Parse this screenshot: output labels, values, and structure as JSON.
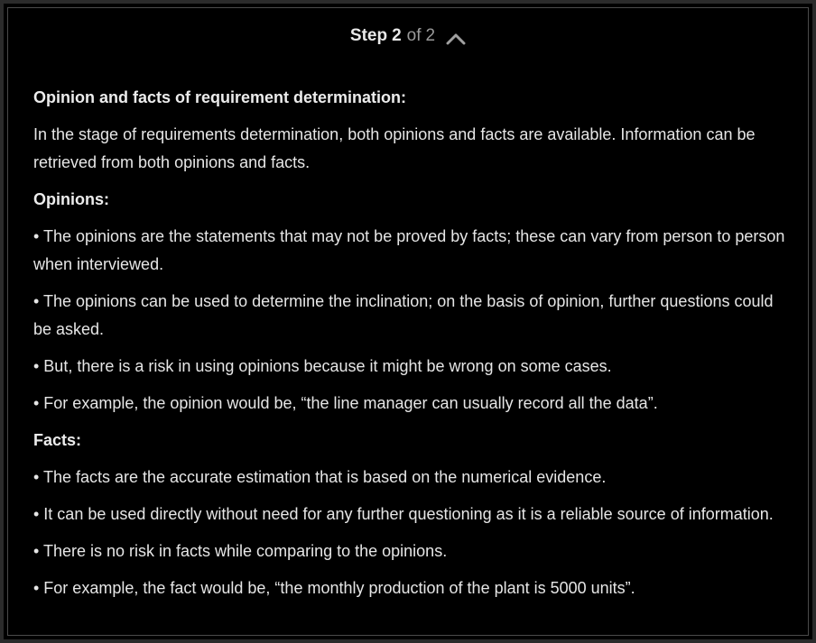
{
  "step_header": {
    "step_word": "Step",
    "current": "2",
    "of_word": "of",
    "total": "2",
    "toggle_icon": "chevron-up-icon"
  },
  "content": {
    "title": "Opinion and facts of requirement determination:",
    "intro": "In the stage of requirements determination, both opinions and facts are available. Information can be retrieved from both opinions and facts.",
    "opinions_heading": "Opinions:",
    "opinions": [
      "• The opinions are the statements that may not be proved by facts; these can vary from person to person when interviewed.",
      "• The opinions can be used to determine the inclination; on the basis of opinion, further questions could be asked.",
      "• But, there is a risk in using opinions because it might be wrong on some cases.",
      "• For example, the opinion would be, “the line manager can usually record all the data”."
    ],
    "facts_heading": "Facts:",
    "facts": [
      "• The facts are the accurate estimation that is based on the numerical evidence.",
      "• It can be used directly without need for any further questioning as it is a reliable source of information.",
      "• There is no risk in facts while comparing to the opinions.",
      "• For example, the fact would be, “the monthly production of the plant is 5000 units”."
    ]
  },
  "colors": {
    "background": "#000000",
    "text": "#e6e6e6",
    "muted": "#9a9a9a",
    "border": "#2b2b2b"
  }
}
